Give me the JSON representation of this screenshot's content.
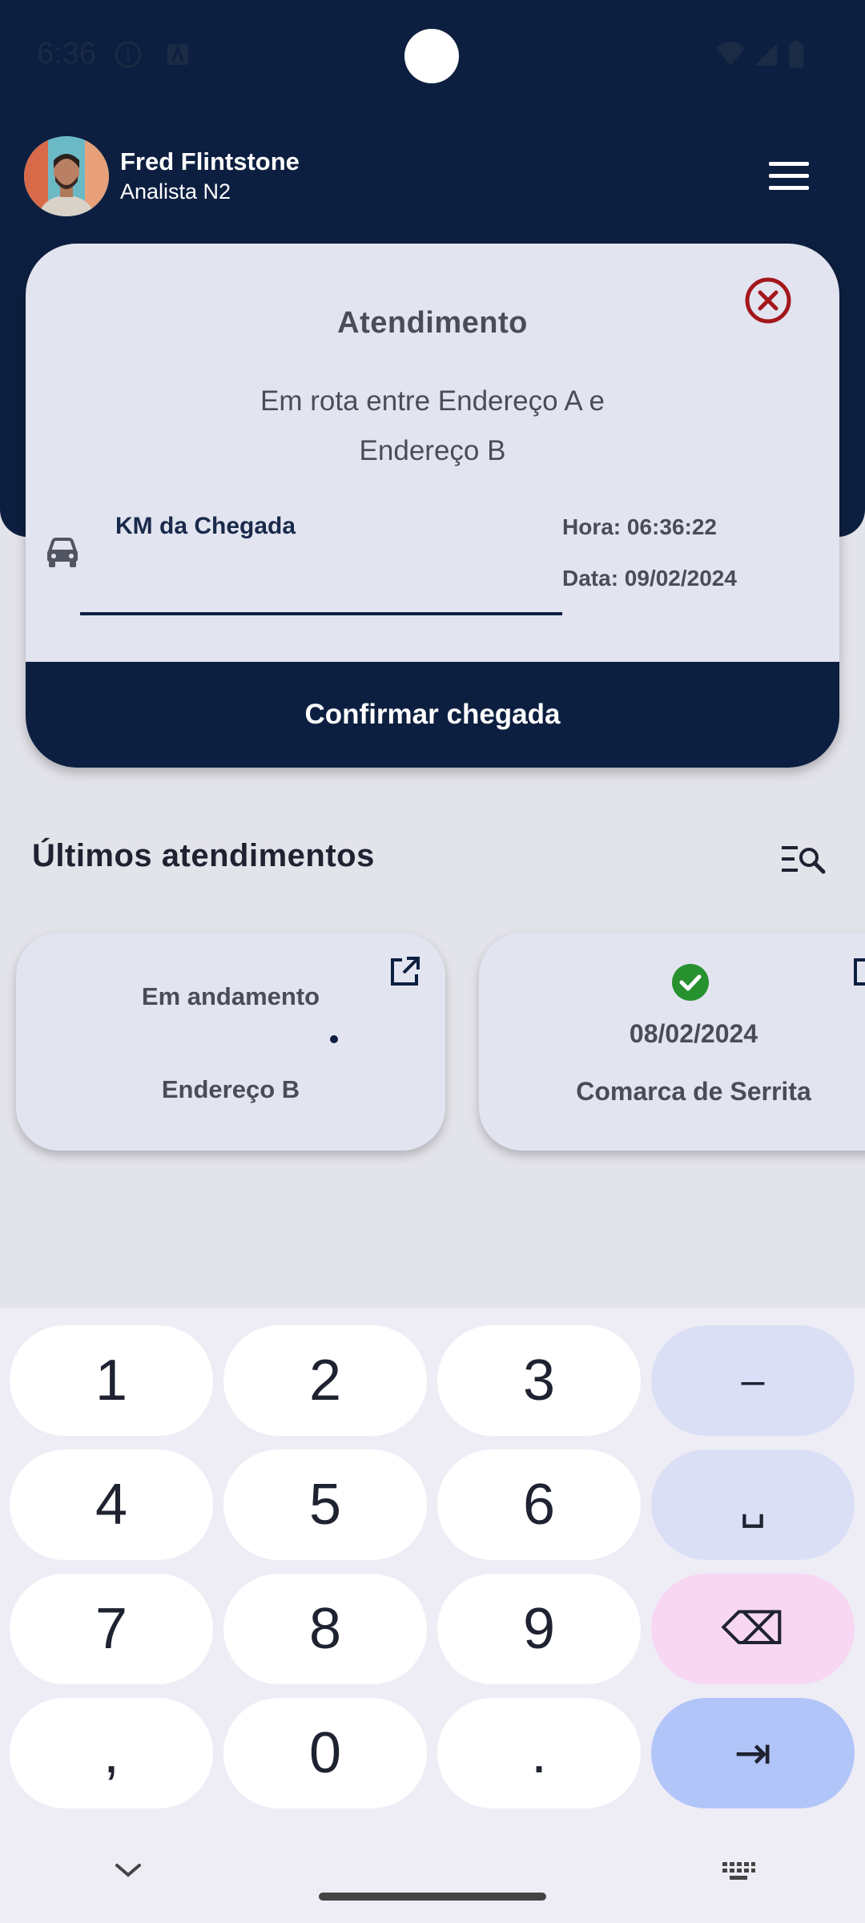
{
  "status_bar": {
    "time": "6:36"
  },
  "profile": {
    "name": "Fred Flintstone",
    "role": "Analista N2"
  },
  "card": {
    "title": "Atendimento",
    "subtitle": "Em rota entre Endereço A e Endereço B",
    "km_label": "KM da Chegada",
    "km_value": "",
    "time_label": "Hora: 06:36:22",
    "date_label": "Data: 09/02/2024",
    "confirm_label": "Confirmar chegada"
  },
  "section": {
    "title": "Últimos atendimentos"
  },
  "atendimentos": [
    {
      "status": "Em andamento",
      "address": "Endereço B"
    },
    {
      "date": "08/02/2024",
      "place": "Comarca de Serrita"
    }
  ],
  "keyboard": {
    "keys": [
      "1",
      "2",
      "3",
      "–",
      "4",
      "5",
      "6",
      "␣",
      "7",
      "8",
      "9",
      "⌫",
      ",",
      "0",
      ".",
      "⇥"
    ]
  },
  "colors": {
    "primary": "#0d1f40",
    "danger": "#a3171c",
    "success": "#27912f"
  }
}
